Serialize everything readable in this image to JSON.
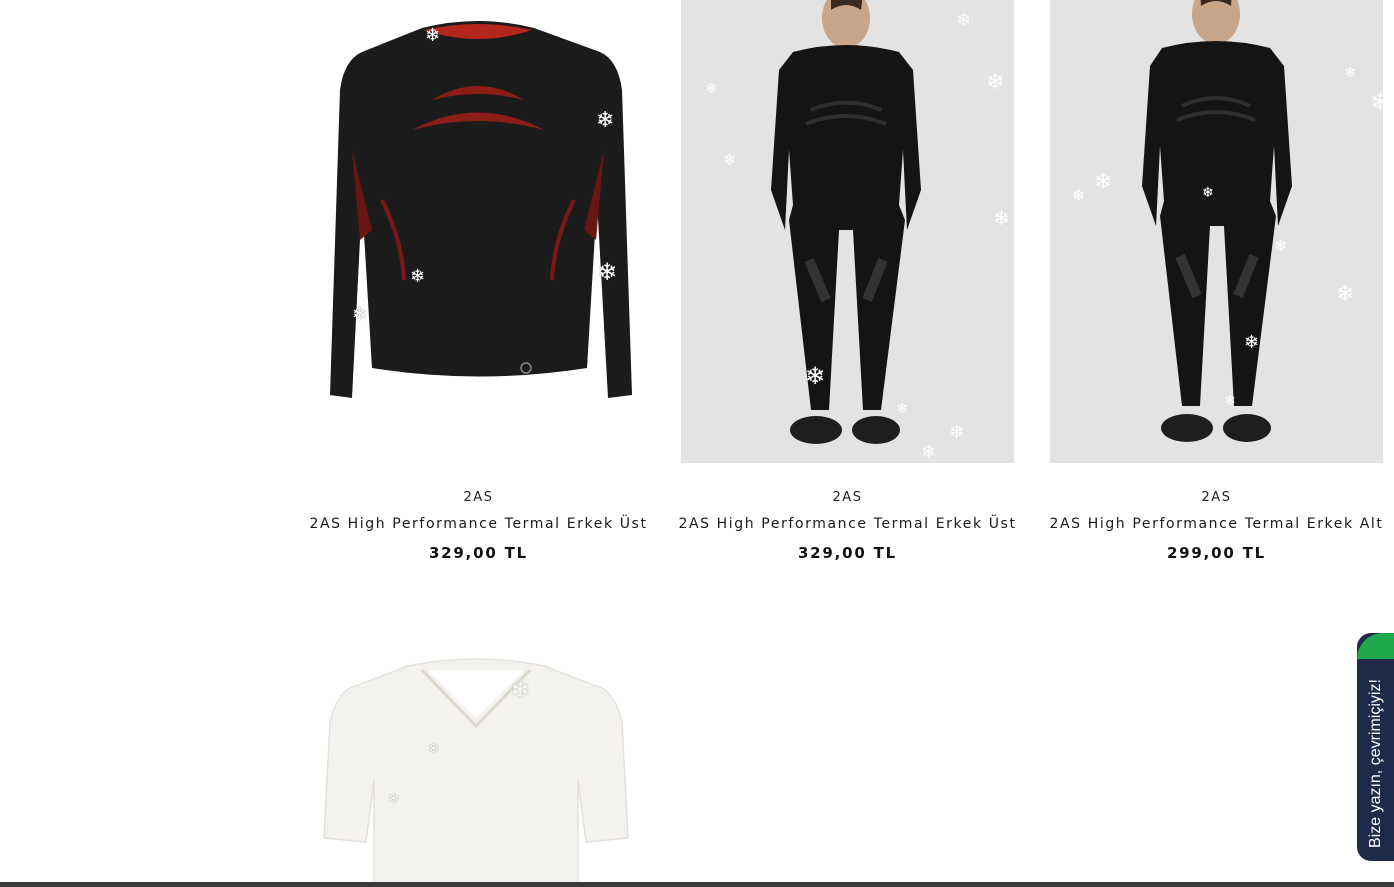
{
  "products": [
    {
      "vendor": "2AS",
      "title": "2AS High Performance Termal Erkek Üst",
      "price": "329,00 TL",
      "image": "black-red-thermal-top"
    },
    {
      "vendor": "2AS",
      "title": "2AS High Performance Termal Erkek Üst",
      "price": "329,00 TL",
      "image": "model-black-thermal-set"
    },
    {
      "vendor": "2AS",
      "title": "2AS High Performance Termal Erkek Alt",
      "price": "299,00 TL",
      "image": "model-black-thermal-set"
    },
    {
      "image": "white-vneck-tshirt"
    }
  ],
  "chat": {
    "label": "Bize yazın, çevrimiçiyiz!"
  },
  "decor": {
    "snowflake_icon": "snowflake-icon",
    "accent_green": "#1fa84b",
    "chat_bg": "#1d2a4a"
  }
}
